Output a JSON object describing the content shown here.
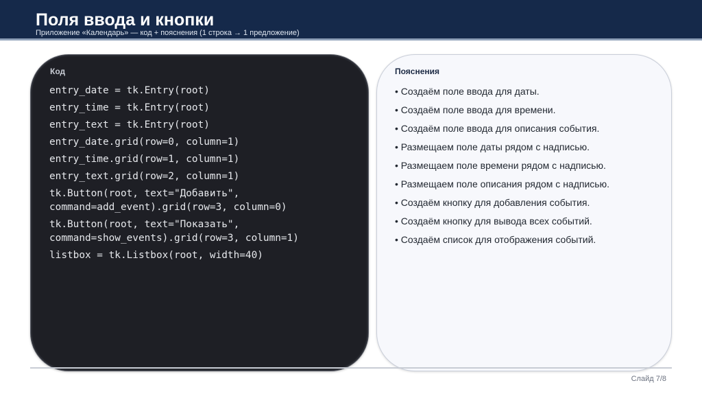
{
  "header": {
    "title": "Поля ввода и кнопки",
    "subtitle": "Приложение «Календарь» — код + пояснения (1 строка → 1 предложение)"
  },
  "code_panel": {
    "label": "Код",
    "lines": [
      "entry_date = tk.Entry(root)",
      "entry_time = tk.Entry(root)",
      "entry_text = tk.Entry(root)",
      "entry_date.grid(row=0, column=1)",
      "entry_time.grid(row=1, column=1)",
      "entry_text.grid(row=2, column=1)",
      "tk.Button(root, text=\"Добавить\",\ncommand=add_event).grid(row=3, column=0)",
      "tk.Button(root, text=\"Показать\",\ncommand=show_events).grid(row=3, column=1)",
      "listbox = tk.Listbox(root, width=40)"
    ]
  },
  "notes_panel": {
    "label": "Пояснения",
    "items": [
      "• Создаём поле ввода для даты.",
      "• Создаём поле ввода для времени.",
      "• Создаём поле ввода для описания события.",
      "• Размещаем поле даты рядом с надписью.",
      "• Размещаем поле времени рядом с надписью.",
      "• Размещаем поле описания рядом с надписью.",
      "• Создаём кнопку для добавления события.",
      "• Создаём кнопку для вывода всех событий.",
      "• Создаём список для отображения событий."
    ]
  },
  "footer": {
    "slide_number": "Слайд 7/8"
  },
  "colors": {
    "header_bg": "#15294a",
    "code_bg": "#1e1f25",
    "notes_bg": "#f7f8fc"
  }
}
